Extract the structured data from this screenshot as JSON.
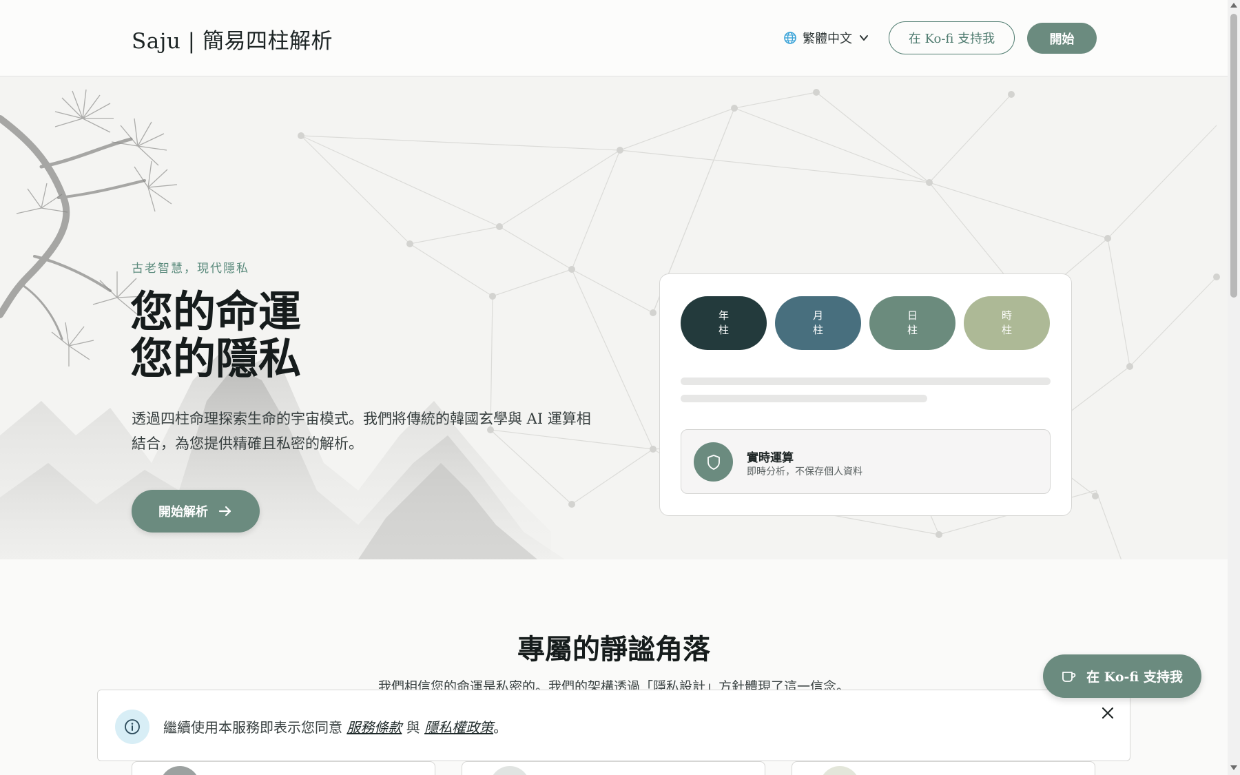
{
  "header": {
    "brand": "Saju | 簡易四柱解析",
    "language": "繁體中文",
    "kofi_label": "在 Ko-fi 支持我",
    "start_label": "開始"
  },
  "hero": {
    "tagline": "古老智慧，現代隱私",
    "headline_line1": "您的命運",
    "headline_line2": "您的隱私",
    "description": "透過四柱命理探索生命的宇宙模式。我們將傳統的韓國玄學與 AI 運算相結合，為您提供精確且私密的解析。",
    "cta_label": "開始解析"
  },
  "card": {
    "pillars": [
      {
        "top": "年",
        "bottom": "柱",
        "color": "#233a3c"
      },
      {
        "top": "月",
        "bottom": "柱",
        "color": "#486f7e"
      },
      {
        "top": "日",
        "bottom": "柱",
        "color": "#6b8b7d"
      },
      {
        "top": "時",
        "bottom": "柱",
        "color": "#adb996"
      }
    ],
    "compute_title": "實時運算",
    "compute_sub": "即時分析，不保存個人資料"
  },
  "section": {
    "title": "專屬的靜謐角落",
    "subtitle": "我們相信您的命運是私密的。我們的架構透過「隱私設計」方針體現了這一信念。"
  },
  "float_kofi_label": "在 Ko-fi 支持我",
  "terms": {
    "prefix": "繼續使用本服務即表示您同意 ",
    "terms_link": "服務條款",
    "middle": " 與 ",
    "privacy_link": "隱私權政策",
    "suffix": "。"
  },
  "colors": {
    "accent": "#6b8b7f",
    "accent_dark": "#4d7a6e",
    "info_bg": "#d8eef6"
  }
}
